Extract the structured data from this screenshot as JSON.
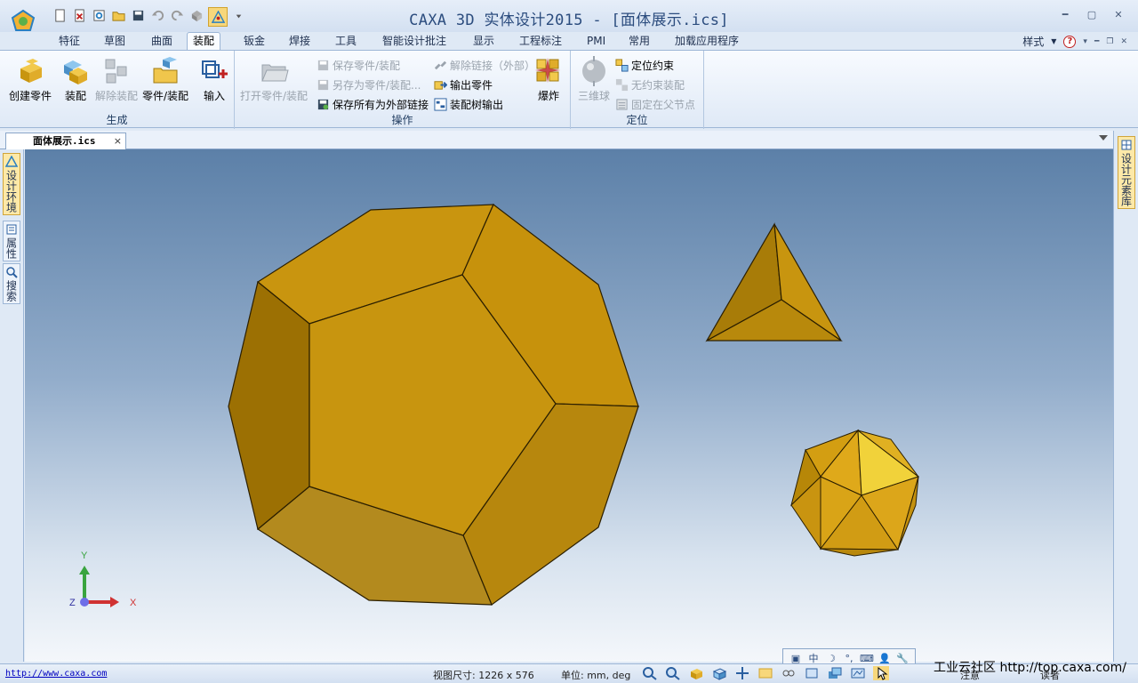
{
  "window": {
    "title": "CAXA 3D 实体设计2015 - [面体展示.ics]"
  },
  "quick_access": [
    "new-icon",
    "open-template-icon",
    "refresh-icon",
    "folder-open-icon",
    "save-icon",
    "undo-icon",
    "redo-icon",
    "shape-icon",
    "design-mode-icon",
    "dropdown-icon"
  ],
  "tabs": [
    {
      "label": "特征"
    },
    {
      "label": "草图"
    },
    {
      "label": "曲面"
    },
    {
      "label": "装配"
    },
    {
      "label": "钣金"
    },
    {
      "label": "焊接"
    },
    {
      "label": "工具"
    },
    {
      "label": "智能设计批注"
    },
    {
      "label": "显示"
    },
    {
      "label": "工程标注"
    },
    {
      "label": "PMI"
    },
    {
      "label": "常用"
    },
    {
      "label": "加载应用程序"
    }
  ],
  "tab_right": {
    "style_label": "样式",
    "help_label": "?"
  },
  "ribbon": {
    "group_generate": {
      "label": "生成",
      "create_part": "创建零件",
      "assemble": "装配",
      "disassemble": "解除装配",
      "part_assembly": "零件/装配",
      "import": "输入"
    },
    "group_operate": {
      "label": "操作",
      "open_part": "打开零件/装配",
      "save_part": "保存零件/装配",
      "save_as_part": "另存为零件/装配...",
      "save_all_external": "保存所有为外部链接",
      "unlink_external": "解除链接（外部）",
      "export_part": "输出零件",
      "export_tree": "装配树输出",
      "explode": "爆炸"
    },
    "group_position": {
      "label": "定位",
      "three_ball": "三维球",
      "position_constraint": "定位约束",
      "unconstrained": "无约束装配",
      "fix_parent": "固定在父节点"
    }
  },
  "document": {
    "tab_label": "面体展示.ics",
    "close": "×"
  },
  "left_panel": {
    "design_env": "设计环境",
    "properties": "属性",
    "search": "搜索"
  },
  "right_panel": {
    "design_library": "设计元素库"
  },
  "axes": {
    "x": "X",
    "y": "Y",
    "z": "Z"
  },
  "mini_toolbar": [
    "中",
    "☽",
    "°,",
    "⌨",
    "👤",
    "🔧"
  ],
  "status": {
    "link": "http://www.caxa.com",
    "view_size": "视图尺寸: 1226 x  576",
    "unit": "单位: mm, deg",
    "note": "注意",
    "read": "读者"
  },
  "watermark": "工业云社区 http://top.caxa.com/",
  "colors": {
    "solid_face": "#c8950f",
    "solid_dark": "#9c7003",
    "solid_light": "#f1d23a",
    "viewport_top": "#5c80a8",
    "viewport_bottom": "#f4f7fb"
  }
}
